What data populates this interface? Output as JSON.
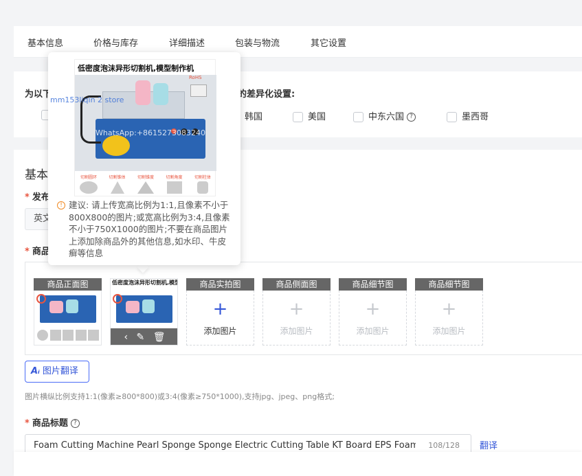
{
  "tabs": [
    "基本信息",
    "价格与库存",
    "详细描述",
    "包装与物流",
    "其它设置"
  ],
  "diff_section": {
    "title_prefix": "为以下",
    "title_suffix": "的差异化设置:",
    "countries": [
      "韩国",
      "美国",
      "中东六国",
      "墨西哥"
    ]
  },
  "basic": {
    "heading": "基本",
    "publish_label": "发布",
    "publish_value": "英文",
    "images_label": "商品"
  },
  "popover": {
    "product_title": "低密度泡沫异形切割机,模型制作机",
    "watermark_store": "mm153liqin 2 store",
    "watermark_whatsapp": "WhatsApp:+8615273083240",
    "badge": "RoHS",
    "feature_labels": [
      "切割圆环",
      "切割锥体",
      "切割锥度",
      "切割角度",
      "切割柱体"
    ],
    "hint": "建议: 请上传宽高比例为1:1,且像素不小于800X800的图片;或宽高比例为3:4,且像素不小于750X1000的图片;不要在商品图片上添加除商品外的其他信息,如水印、牛皮癣等信息"
  },
  "image_slots": [
    {
      "label": "商品正面图",
      "filled": true
    },
    {
      "label": "",
      "filled": true
    },
    {
      "label": "商品实拍图",
      "filled": false,
      "add_text": "添加图片",
      "active": true
    },
    {
      "label": "商品侧面图",
      "filled": false,
      "add_text": "添加图片",
      "active": false
    },
    {
      "label": "商品细节图",
      "filled": false,
      "add_text": "添加图片",
      "active": false
    },
    {
      "label": "商品细节图",
      "filled": false,
      "add_text": "添加图片",
      "active": false
    }
  ],
  "ai_translate_label": "图片翻译",
  "image_tip": "图片横纵比例支持1:1(像素≥800*800)或3:4(像素≥750*1000),支持jpg、jpeg、png格式;",
  "title_field": {
    "label": "商品标题",
    "value": "Foam Cutting Machine Pearl Sponge Sponge Electric Cutting Table KT Board EPS Foam Electric",
    "count": "108/128",
    "translate_label": "翻译"
  },
  "colors": {
    "accent": "#3557d8",
    "required": "#e8553f",
    "warning": "#f08a24",
    "machine_blue": "#2a64b3"
  }
}
